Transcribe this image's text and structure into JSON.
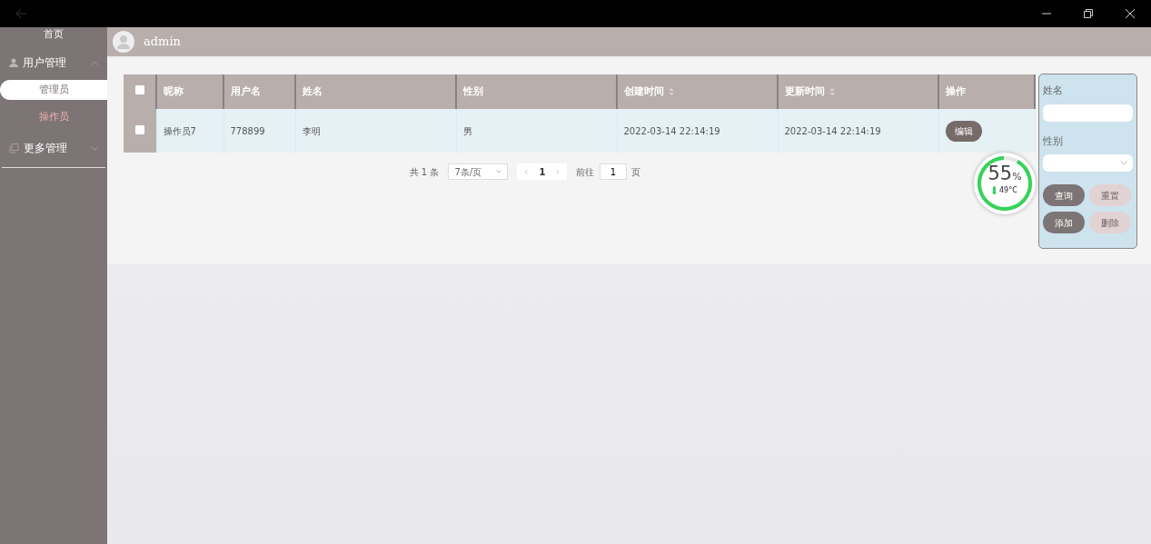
{
  "sidebar": {
    "items": [
      {
        "label": "首页",
        "kind": "link"
      },
      {
        "label": "用户管理",
        "kind": "group",
        "expanded": true,
        "children": [
          {
            "label": "管理员",
            "selected": true
          },
          {
            "label": "操作员",
            "selected": false
          }
        ]
      },
      {
        "label": "更多管理",
        "kind": "group",
        "expanded": false
      }
    ]
  },
  "header": {
    "user": "admin"
  },
  "table": {
    "select_all_checked": false,
    "columns": [
      {
        "label": "昵称",
        "sortable": false
      },
      {
        "label": "用户名",
        "sortable": false
      },
      {
        "label": "姓名",
        "sortable": false
      },
      {
        "label": "性别",
        "sortable": false
      },
      {
        "label": "创建时间",
        "sortable": true
      },
      {
        "label": "更新时间",
        "sortable": true
      },
      {
        "label": "操作",
        "sortable": false
      }
    ],
    "rows": [
      {
        "checked": false,
        "cells": [
          "操作员7",
          "778899",
          "李明",
          "男",
          "2022-03-14 22:14:19",
          "2022-03-14 22:14:19"
        ],
        "action": "编辑"
      }
    ]
  },
  "pagination": {
    "total": "共 1 条",
    "page_size": "7条/页",
    "current": "1",
    "goto_label": "前往",
    "goto_value": "1",
    "page_suffix": "页"
  },
  "search_panel": {
    "fields": [
      {
        "label": "姓名",
        "kind": "text"
      },
      {
        "label": "性别",
        "kind": "select"
      }
    ],
    "buttons": [
      {
        "label": "查询",
        "kind": "primary"
      },
      {
        "label": "重置",
        "kind": "light"
      },
      {
        "label": "添加",
        "kind": "primary"
      },
      {
        "label": "删除",
        "kind": "light"
      }
    ]
  },
  "monitor": {
    "percent": "55",
    "unit": "%",
    "temperature": "49°C"
  }
}
